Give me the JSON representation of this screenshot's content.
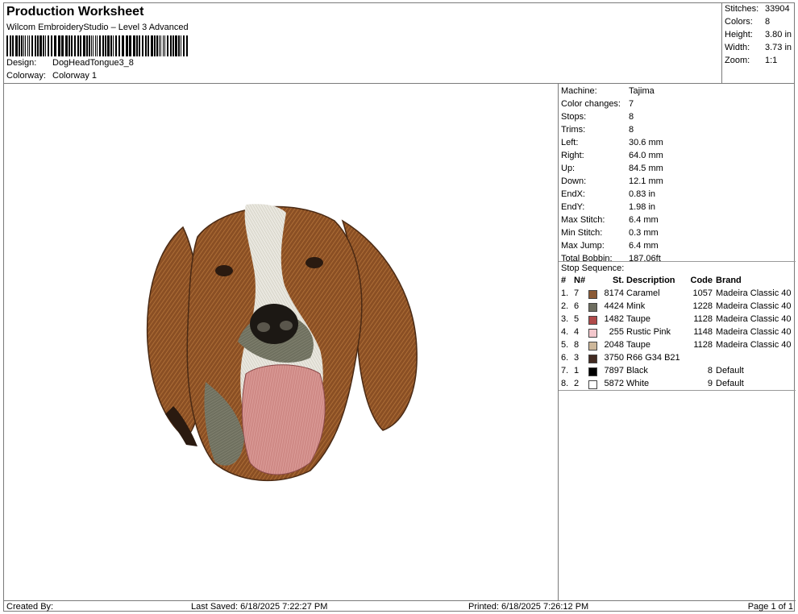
{
  "header": {
    "title": "Production Worksheet",
    "software": "Wilcom EmbroideryStudio – Level 3 Advanced",
    "design_label": "Design:",
    "design_value": "DogHeadTongue3_8",
    "colorway_label": "Colorway:",
    "colorway_value": "Colorway 1"
  },
  "stats": [
    {
      "label": "Stitches:",
      "value": "33904"
    },
    {
      "label": "Colors:",
      "value": "8"
    },
    {
      "label": "Height:",
      "value": "3.80 in"
    },
    {
      "label": "Width:",
      "value": "3.73 in"
    },
    {
      "label": "Zoom:",
      "value": "1:1"
    }
  ],
  "machine_info": [
    {
      "label": "Machine:",
      "value": "Tajima"
    },
    {
      "label": "Color changes:",
      "value": "7"
    },
    {
      "label": "Stops:",
      "value": "8"
    },
    {
      "label": "Trims:",
      "value": "8"
    },
    {
      "label": "Left:",
      "value": "30.6 mm"
    },
    {
      "label": "Right:",
      "value": "64.0 mm"
    },
    {
      "label": "Up:",
      "value": "84.5 mm"
    },
    {
      "label": "Down:",
      "value": "12.1 mm"
    },
    {
      "label": "EndX:",
      "value": "0.83 in"
    },
    {
      "label": "EndY:",
      "value": "1.98 in"
    },
    {
      "label": "Max Stitch:",
      "value": "6.4 mm"
    },
    {
      "label": "Min Stitch:",
      "value": "0.3 mm"
    },
    {
      "label": "Max Jump:",
      "value": "6.4 mm"
    },
    {
      "label": "Total Bobbin:",
      "value": "187.06ft"
    }
  ],
  "stop_sequence": {
    "label": "Stop Sequence:",
    "headers": {
      "idx": "#",
      "n": "N#",
      "st": "St.",
      "desc": "Description",
      "code": "Code",
      "brand": "Brand"
    },
    "rows": [
      {
        "idx": "1.",
        "n": "7",
        "color": "#8b5a35",
        "st": "8174",
        "desc": "Caramel",
        "code": "1057",
        "brand": "Madeira Classic 40"
      },
      {
        "idx": "2.",
        "n": "6",
        "color": "#6e6e60",
        "st": "4424",
        "desc": "Mink",
        "code": "1228",
        "brand": "Madeira Classic 40"
      },
      {
        "idx": "3.",
        "n": "5",
        "color": "#b04a4a",
        "st": "1482",
        "desc": "Taupe",
        "code": "1128",
        "brand": "Madeira Classic 40"
      },
      {
        "idx": "4.",
        "n": "4",
        "color": "#f3c7cc",
        "st": "255",
        "desc": "Rustic Pink",
        "code": "1148",
        "brand": "Madeira Classic 40"
      },
      {
        "idx": "5.",
        "n": "8",
        "color": "#cdb79a",
        "st": "2048",
        "desc": "Taupe",
        "code": "1128",
        "brand": "Madeira Classic 40"
      },
      {
        "idx": "6.",
        "n": "3",
        "color": "#422b22",
        "st": "3750",
        "desc": "R66 G34 B21",
        "code": "",
        "brand": ""
      },
      {
        "idx": "7.",
        "n": "1",
        "color": "#000000",
        "st": "7897",
        "desc": "Black",
        "code": "8",
        "brand": "Default"
      },
      {
        "idx": "8.",
        "n": "2",
        "color": "#ffffff",
        "st": "5872",
        "desc": "White",
        "code": "9",
        "brand": "Default"
      }
    ]
  },
  "footer": {
    "created": "Created By:",
    "saved": "Last Saved: 6/18/2025 7:22:27 PM",
    "printed": "Printed: 6/18/2025 7:26:12 PM",
    "page": "Page 1 of 1"
  }
}
